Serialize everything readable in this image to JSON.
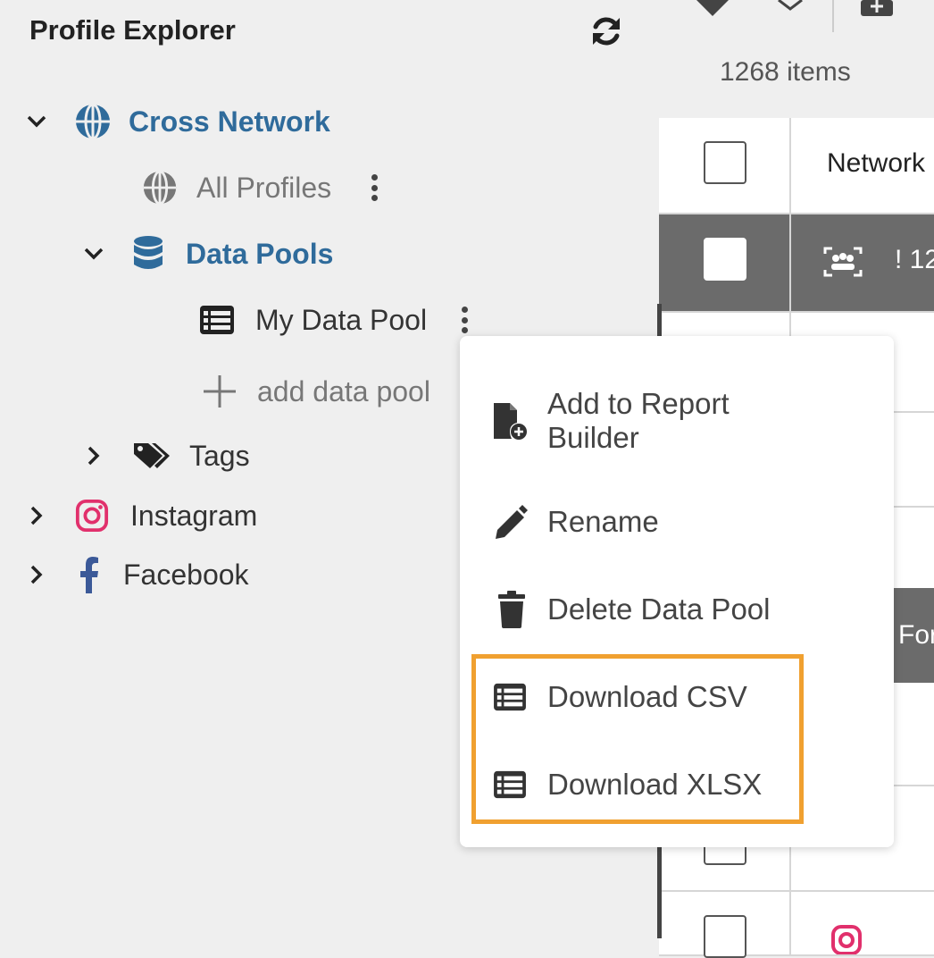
{
  "sidebar": {
    "title": "Profile Explorer",
    "refresh_icon": "refresh-icon",
    "tree": {
      "cross_network": "Cross Network",
      "all_profiles": "All Profiles",
      "data_pools": "Data Pools",
      "my_data_pool": "My Data Pool",
      "add_data_pool": "add data pool",
      "tags": "Tags",
      "instagram": "Instagram",
      "facebook": "Facebook"
    }
  },
  "content": {
    "items_count": "1268 items",
    "table": {
      "header_col": "Network",
      "selected_row_text": "! 12",
      "button_partial": "For"
    }
  },
  "context_menu": {
    "items": [
      {
        "label_line1": "Add to Report",
        "label_line2": "Builder",
        "icon": "file-plus-icon"
      },
      {
        "label": "Rename",
        "icon": "pencil-icon"
      },
      {
        "label": "Delete Data Pool",
        "icon": "trash-icon"
      },
      {
        "label": "Download CSV",
        "icon": "table-icon"
      },
      {
        "label": "Download XLSX",
        "icon": "table-icon"
      }
    ]
  },
  "colors": {
    "accent_blue": "#2f6b9b",
    "highlight_orange": "#f0a030",
    "instagram_pink": "#e1306c",
    "facebook_blue": "#3b5998"
  }
}
